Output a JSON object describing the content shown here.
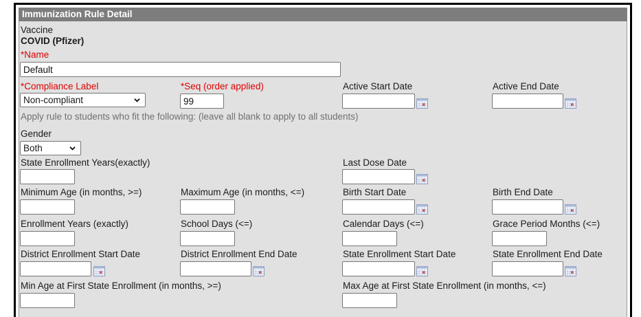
{
  "panel": {
    "title": "Immunization Rule Detail"
  },
  "vaccine": {
    "label": "Vaccine",
    "value": "COVID (Pfizer)"
  },
  "name": {
    "label": "*Name",
    "value": "Default"
  },
  "compliance": {
    "label": "*Compliance Label",
    "selected": "Non-compliant"
  },
  "seq": {
    "label": "*Seq (order applied)",
    "value": "99"
  },
  "active_start": {
    "label": "Active Start Date",
    "value": ""
  },
  "active_end": {
    "label": "Active End Date",
    "value": ""
  },
  "apply_hint": "Apply rule to students who fit the following: (leave all blank to apply to all students)",
  "gender": {
    "label": "Gender",
    "selected": "Both"
  },
  "state_enroll_years": {
    "label": "State Enrollment Years(exactly)",
    "value": ""
  },
  "last_dose": {
    "label": "Last Dose Date",
    "value": ""
  },
  "min_age": {
    "label": "Minimum Age (in months, >=)",
    "value": ""
  },
  "max_age": {
    "label": "Maximum Age (in months, <=)",
    "value": ""
  },
  "birth_start": {
    "label": "Birth Start Date",
    "value": ""
  },
  "birth_end": {
    "label": "Birth End Date",
    "value": ""
  },
  "enroll_years": {
    "label": "Enrollment Years (exactly)",
    "value": ""
  },
  "school_days": {
    "label": "School Days (<=)",
    "value": ""
  },
  "calendar_days": {
    "label": "Calendar Days (<=)",
    "value": ""
  },
  "grace_months": {
    "label": "Grace Period Months (<=)",
    "value": ""
  },
  "district_start": {
    "label": "District Enrollment Start Date",
    "value": ""
  },
  "district_end": {
    "label": "District Enrollment End Date",
    "value": ""
  },
  "state_start": {
    "label": "State Enrollment Start Date",
    "value": ""
  },
  "state_end": {
    "label": "State Enrollment End Date",
    "value": ""
  },
  "min_age_first_state": {
    "label": "Min Age at First State Enrollment (in months, >=)",
    "value": ""
  },
  "max_age_first_state": {
    "label": "Max Age at First State Enrollment (in months, <=)",
    "value": ""
  },
  "colors": {
    "titlebar": "#7d7d7d",
    "panel": "#e1e1e1",
    "required": "#e00000",
    "hint": "#707070"
  },
  "icons": {
    "calendar": "calendar-icon",
    "dropdown": "chevron-down-icon"
  }
}
